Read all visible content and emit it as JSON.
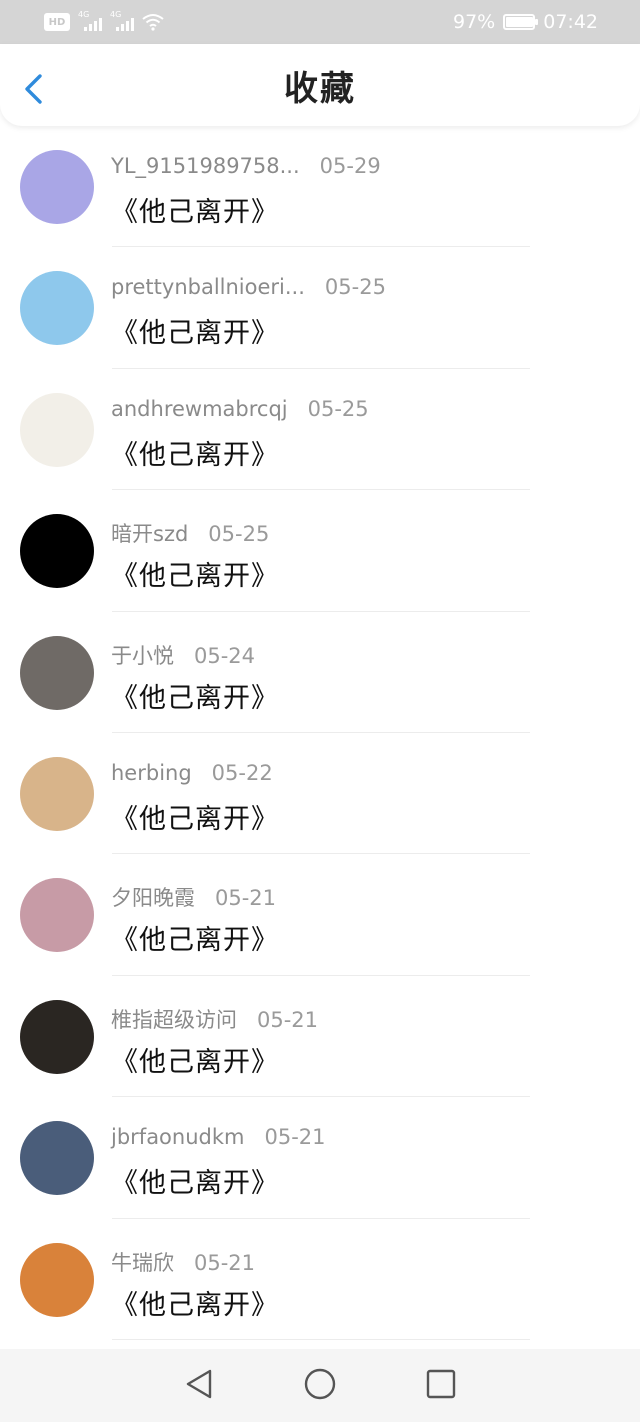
{
  "status_bar": {
    "badge": "HD",
    "network_1": "4G",
    "network_2": "4G",
    "battery": "97%",
    "battery_level": 0.97,
    "time": "07:42"
  },
  "header": {
    "title": "收藏"
  },
  "items": [
    {
      "name": "YL_9151989758...",
      "date": "05-29",
      "title": "《他己离开》",
      "avatar_color": "#a9a6e6"
    },
    {
      "name": "prettynballnioeri...",
      "date": "05-25",
      "title": "《他己离开》",
      "avatar_color": "#8ec8ec"
    },
    {
      "name": "andhrewmabrcqj",
      "date": "05-25",
      "title": "《他己离开》",
      "avatar_color": "#f2efe8"
    },
    {
      "name": "暗开szd",
      "date": "05-25",
      "title": "《他己离开》",
      "avatar_color": "#000000"
    },
    {
      "name": "于小悦",
      "date": "05-24",
      "title": "《他己离开》",
      "avatar_color": "#6f6a66"
    },
    {
      "name": "herbing",
      "date": "05-22",
      "title": "《他己离开》",
      "avatar_color": "#d8b48a"
    },
    {
      "name": "夕阳晚霞",
      "date": "05-21",
      "title": "《他己离开》",
      "avatar_color": "#c79ba6"
    },
    {
      "name": "椎指超级访问",
      "date": "05-21",
      "title": "《他己离开》",
      "avatar_color": "#2a2622"
    },
    {
      "name": "jbrfaonudkm",
      "date": "05-21",
      "title": "《他己离开》",
      "avatar_color": "#4a5d7a"
    },
    {
      "name": "牛瑞欣",
      "date": "05-21",
      "title": "《他己离开》",
      "avatar_color": "#d9823a"
    }
  ],
  "colors": {
    "accent": "#2f8bdc",
    "status_bar_bg": "#d5d5d5",
    "nav_bar_bg": "#f5f5f5"
  }
}
